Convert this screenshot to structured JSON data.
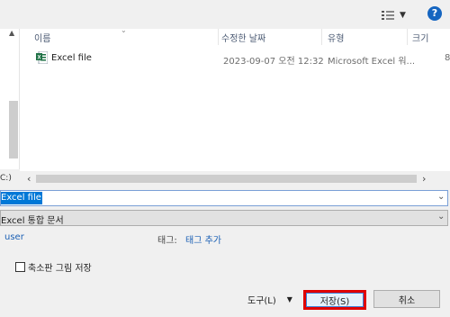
{
  "toolbar": {
    "view_icon": "view-list-icon",
    "help_label": "?"
  },
  "file_list": {
    "columns": [
      "이름",
      "수정한 날짜",
      "유형",
      "크기"
    ],
    "rows": [
      {
        "name": "Excel file",
        "modified": "2023-09-07 오전 12:32",
        "type": "Microsoft Excel 워...",
        "size": "8"
      }
    ]
  },
  "hscroll": {
    "cut_label": "C:)"
  },
  "save_form": {
    "file_name": "Excel file",
    "file_type": "Excel 통합 문서",
    "author": "user",
    "tags_label": "태그:",
    "tags_link": "태그 추가",
    "thumbnail_label": "축소판 그림 저장",
    "thumbnail_checked": false
  },
  "buttons": {
    "tools": "도구(L)",
    "save": "저장(S)",
    "cancel": "취소"
  },
  "colors": {
    "accent": "#0078d7",
    "help": "#1565c0",
    "save_highlight": "#e00000",
    "excel_green": "#1e7145"
  }
}
